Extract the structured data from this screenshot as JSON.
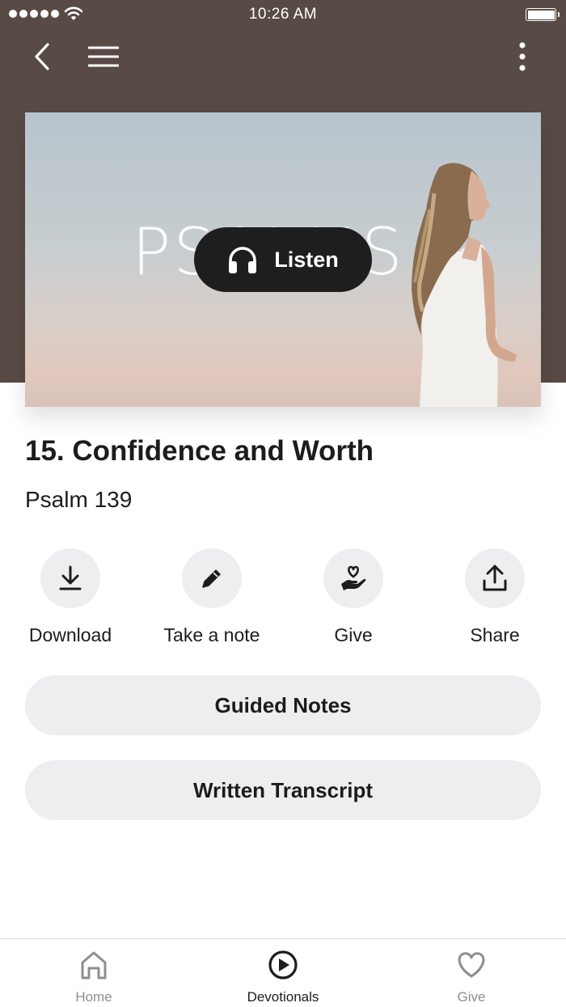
{
  "status_bar": {
    "time": "10:26 AM"
  },
  "hero": {
    "image_title": "PSALMS",
    "listen_label": "Listen"
  },
  "episode": {
    "title": "15. Confidence and Worth",
    "passage": "Psalm 139"
  },
  "actions": [
    {
      "label": "Download",
      "icon": "download-icon"
    },
    {
      "label": "Take a note",
      "icon": "pencil-icon"
    },
    {
      "label": "Give",
      "icon": "heart-hand-icon"
    },
    {
      "label": "Share",
      "icon": "share-icon"
    }
  ],
  "buttons": {
    "guided_notes": "Guided Notes",
    "written_transcript": "Written Transcript"
  },
  "tabs": [
    {
      "label": "Home",
      "icon": "home-icon",
      "active": false
    },
    {
      "label": "Devotionals",
      "icon": "play-circle-icon",
      "active": true
    },
    {
      "label": "Give",
      "icon": "heart-icon",
      "active": false
    }
  ],
  "colors": {
    "header_bg": "#584a44",
    "button_bg": "#eeeef0",
    "listen_bg": "#1e1e1e",
    "text": "#1c1c1e",
    "inactive_tab": "#8e8e93"
  }
}
